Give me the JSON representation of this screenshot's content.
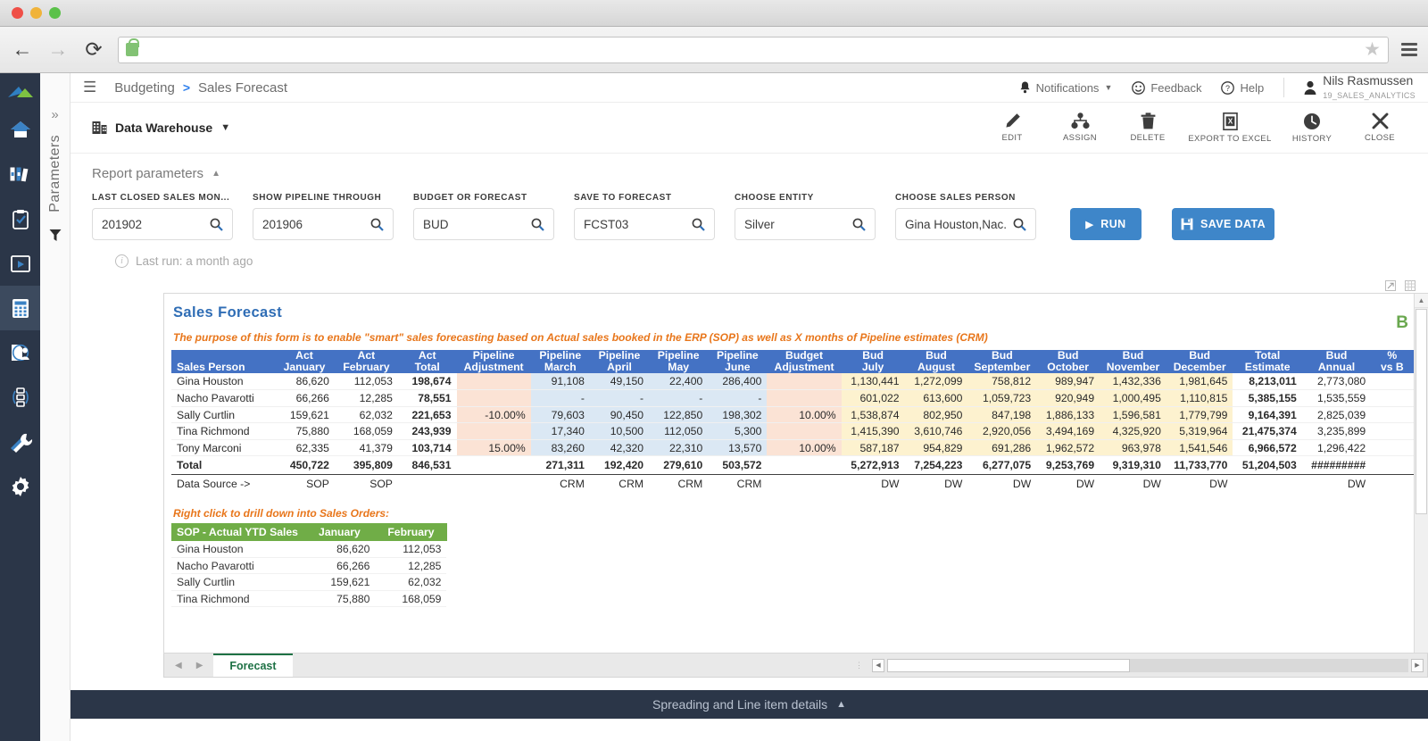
{
  "browser": {
    "back_icon": "back-arrow-icon",
    "forward_icon": "forward-arrow-icon",
    "reload_icon": "reload-icon",
    "lock_icon": "secure-lock-icon",
    "url": "",
    "url_placeholder": "",
    "bookmark_icon": "star-icon",
    "menu_icon": "hamburger-menu-icon"
  },
  "appbar": {
    "menu_icon": "hamburger-menu-icon",
    "breadcrumb": {
      "root": "Budgeting",
      "separator": ">",
      "current": "Sales Forecast"
    },
    "notifications": "Notifications",
    "feedback": "Feedback",
    "help": "Help",
    "user_name": "Nils Rasmussen",
    "user_sub": "19_SALES_ANALYTICS"
  },
  "vstrip": {
    "label": "Parameters",
    "expand_icon": "chevron-double-right-icon",
    "filter_icon": "funnel-icon"
  },
  "subbar": {
    "datasource": "Data Warehouse",
    "actions": [
      {
        "label": "EDIT",
        "icon": "pencil-icon"
      },
      {
        "label": "ASSIGN",
        "icon": "assign-icon"
      },
      {
        "label": "DELETE",
        "icon": "trash-icon"
      },
      {
        "label": "EXPORT TO EXCEL",
        "icon": "excel-export-icon"
      },
      {
        "label": "HISTORY",
        "icon": "history-clock-icon"
      },
      {
        "label": "CLOSE",
        "icon": "close-x-icon"
      }
    ]
  },
  "params": {
    "heading": "Report parameters",
    "collapse_icon": "chevron-up-icon",
    "fields": [
      {
        "label": "LAST CLOSED SALES MON...",
        "value": "201902"
      },
      {
        "label": "SHOW PIPELINE THROUGH",
        "value": "201906"
      },
      {
        "label": "BUDGET OR FORECAST",
        "value": "BUD"
      },
      {
        "label": "SAVE TO FORECAST",
        "value": "FCST03"
      },
      {
        "label": "CHOOSE ENTITY",
        "value": "Silver"
      },
      {
        "label": "CHOOSE SALES PERSON",
        "value": "Gina Houston,Nac..."
      }
    ],
    "run_label": "RUN",
    "save_label": "SAVE DATA",
    "last_run": "Last run: a month ago"
  },
  "sheet": {
    "title": "Sales  Forecast",
    "note": "The purpose of this form is to enable \"smart\" sales forecasting based on Actual sales booked in the ERP (SOP) as well as X months of Pipeline estimates (CRM)",
    "corner_badge": "B",
    "expand_icon": "expand-icon",
    "grid_icon": "grid-icon",
    "drilldown_note": "Right click to drill down into Sales Orders:",
    "columns": [
      {
        "top": "",
        "bottom": "Sales Person",
        "align": "left",
        "fill": "white"
      },
      {
        "top": "Act",
        "bottom": "January",
        "align": "right",
        "fill": "white"
      },
      {
        "top": "Act",
        "bottom": "February",
        "align": "right",
        "fill": "white"
      },
      {
        "top": "Act",
        "bottom": "Total",
        "align": "right",
        "fill": "white",
        "bold": true
      },
      {
        "top": "Pipeline",
        "bottom": "Adjustment",
        "align": "right",
        "fill": "pink"
      },
      {
        "top": "Pipeline",
        "bottom": "March",
        "align": "right",
        "fill": "blue"
      },
      {
        "top": "Pipeline",
        "bottom": "April",
        "align": "right",
        "fill": "blue"
      },
      {
        "top": "Pipeline",
        "bottom": "May",
        "align": "right",
        "fill": "blue"
      },
      {
        "top": "Pipeline",
        "bottom": "June",
        "align": "right",
        "fill": "blue"
      },
      {
        "top": "Budget",
        "bottom": "Adjustment",
        "align": "right",
        "fill": "pink"
      },
      {
        "top": "Bud",
        "bottom": "July",
        "align": "right",
        "fill": "yellow"
      },
      {
        "top": "Bud",
        "bottom": "August",
        "align": "right",
        "fill": "yellow"
      },
      {
        "top": "Bud",
        "bottom": "September",
        "align": "right",
        "fill": "yellow"
      },
      {
        "top": "Bud",
        "bottom": "October",
        "align": "right",
        "fill": "yellow"
      },
      {
        "top": "Bud",
        "bottom": "November",
        "align": "right",
        "fill": "yellow"
      },
      {
        "top": "Bud",
        "bottom": "December",
        "align": "right",
        "fill": "yellow"
      },
      {
        "top": "Total",
        "bottom": "Estimate",
        "align": "right",
        "fill": "white",
        "bold": true
      },
      {
        "top": "Bud",
        "bottom": "Annual",
        "align": "right",
        "fill": "white"
      },
      {
        "top": "%",
        "bottom": "vs B",
        "align": "right",
        "fill": "white"
      }
    ],
    "rows": [
      [
        "Gina Houston",
        "86,620",
        "112,053",
        "198,674",
        "",
        "91,108",
        "49,150",
        "22,400",
        "286,400",
        "",
        "1,130,441",
        "1,272,099",
        "758,812",
        "989,947",
        "1,432,336",
        "1,981,645",
        "8,213,011",
        "2,773,080",
        ""
      ],
      [
        "Nacho Pavarotti",
        "66,266",
        "12,285",
        "78,551",
        "",
        "-",
        "-",
        "-",
        "-",
        "",
        "601,022",
        "613,600",
        "1,059,723",
        "920,949",
        "1,000,495",
        "1,110,815",
        "5,385,155",
        "1,535,559",
        ""
      ],
      [
        "Sally Curtlin",
        "159,621",
        "62,032",
        "221,653",
        "-10.00%",
        "79,603",
        "90,450",
        "122,850",
        "198,302",
        "10.00%",
        "1,538,874",
        "802,950",
        "847,198",
        "1,886,133",
        "1,596,581",
        "1,779,799",
        "9,164,391",
        "2,825,039",
        ""
      ],
      [
        "Tina Richmond",
        "75,880",
        "168,059",
        "243,939",
        "",
        "17,340",
        "10,500",
        "112,050",
        "5,300",
        "",
        "1,415,390",
        "3,610,746",
        "2,920,056",
        "3,494,169",
        "4,325,920",
        "5,319,964",
        "21,475,374",
        "3,235,899",
        ""
      ],
      [
        "Tony Marconi",
        "62,335",
        "41,379",
        "103,714",
        "15.00%",
        "83,260",
        "42,320",
        "22,310",
        "13,570",
        "10.00%",
        "587,187",
        "954,829",
        "691,286",
        "1,962,572",
        "963,978",
        "1,541,546",
        "6,966,572",
        "1,296,422",
        ""
      ]
    ],
    "total_row": [
      "Total",
      "450,722",
      "395,809",
      "846,531",
      "",
      "271,311",
      "192,420",
      "279,610",
      "503,572",
      "",
      "5,272,913",
      "7,254,223",
      "6,277,075",
      "9,253,769",
      "9,319,310",
      "11,733,770",
      "51,204,503",
      "#########",
      ""
    ],
    "source_row": [
      "Data Source ->",
      "SOP",
      "SOP",
      "",
      "",
      "CRM",
      "CRM",
      "CRM",
      "CRM",
      "",
      "DW",
      "DW",
      "DW",
      "DW",
      "DW",
      "DW",
      "",
      "DW",
      ""
    ],
    "sop_table": {
      "headers": [
        "SOP - Actual YTD Sales",
        "January",
        "February"
      ],
      "rows": [
        [
          "Gina Houston",
          "86,620",
          "112,053"
        ],
        [
          "Nacho Pavarotti",
          "66,266",
          "12,285"
        ],
        [
          "Sally Curtlin",
          "159,621",
          "62,032"
        ],
        [
          "Tina Richmond",
          "75,880",
          "168,059"
        ]
      ]
    }
  },
  "tabs": {
    "prev_icon": "tab-prev-icon",
    "next_icon": "tab-next-icon",
    "active": "Forecast"
  },
  "drawer": {
    "label": "Spreading and Line item details",
    "icon": "chevron-up-icon"
  },
  "colors": {
    "accent": "#3e86c9",
    "header_blue": "#4472c4",
    "green": "#70ad47",
    "orange": "#e8761b",
    "rail": "#2b3648"
  }
}
